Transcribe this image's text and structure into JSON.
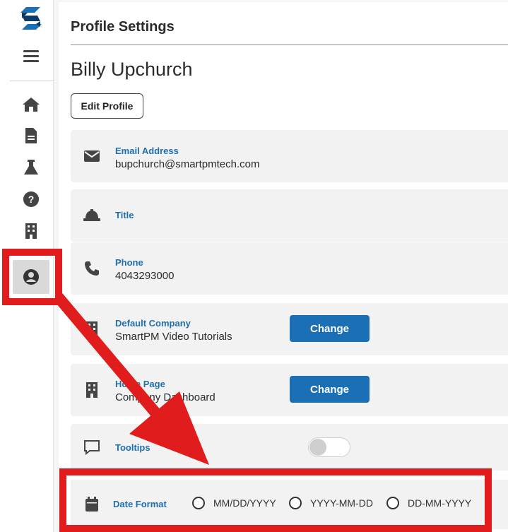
{
  "page": {
    "title": "Profile Settings"
  },
  "user": {
    "name": "Billy Upchurch",
    "edit_label": "Edit Profile"
  },
  "sidebar": {
    "items": [
      {
        "name": "home",
        "icon": "home-icon"
      },
      {
        "name": "documents",
        "icon": "document-icon"
      },
      {
        "name": "lab",
        "icon": "flask-icon"
      },
      {
        "name": "help",
        "icon": "help-icon"
      },
      {
        "name": "companies",
        "icon": "building-icon"
      },
      {
        "name": "profile",
        "icon": "user-circle-icon",
        "active": true
      }
    ]
  },
  "fields": {
    "email": {
      "label": "Email Address",
      "value": "bupchurch@smartpmtech.com",
      "icon": "envelope-icon"
    },
    "title": {
      "label": "Title",
      "icon": "hardhat-icon"
    },
    "phone": {
      "label": "Phone",
      "value": "4043293000",
      "icon": "phone-icon"
    },
    "default_company": {
      "label": "Default Company",
      "value": "SmartPM Video Tutorials",
      "button": "Change",
      "icon": "building-icon"
    },
    "home_page": {
      "label": "Home Page",
      "value": "Company Dashboard",
      "button": "Change",
      "icon": "building-icon"
    },
    "tooltips": {
      "label": "Tooltips",
      "enabled": false,
      "icon": "speech-bubble-icon"
    },
    "date_format": {
      "label": "Date Format",
      "icon": "calendar-icon",
      "options": [
        "MM/DD/YYYY",
        "YYYY-MM-DD",
        "DD-MM-YYYY"
      ],
      "selected": null
    }
  },
  "colors": {
    "accent": "#1b6fb4",
    "label": "#1f6fb0",
    "annotation": "#e11c1c"
  }
}
